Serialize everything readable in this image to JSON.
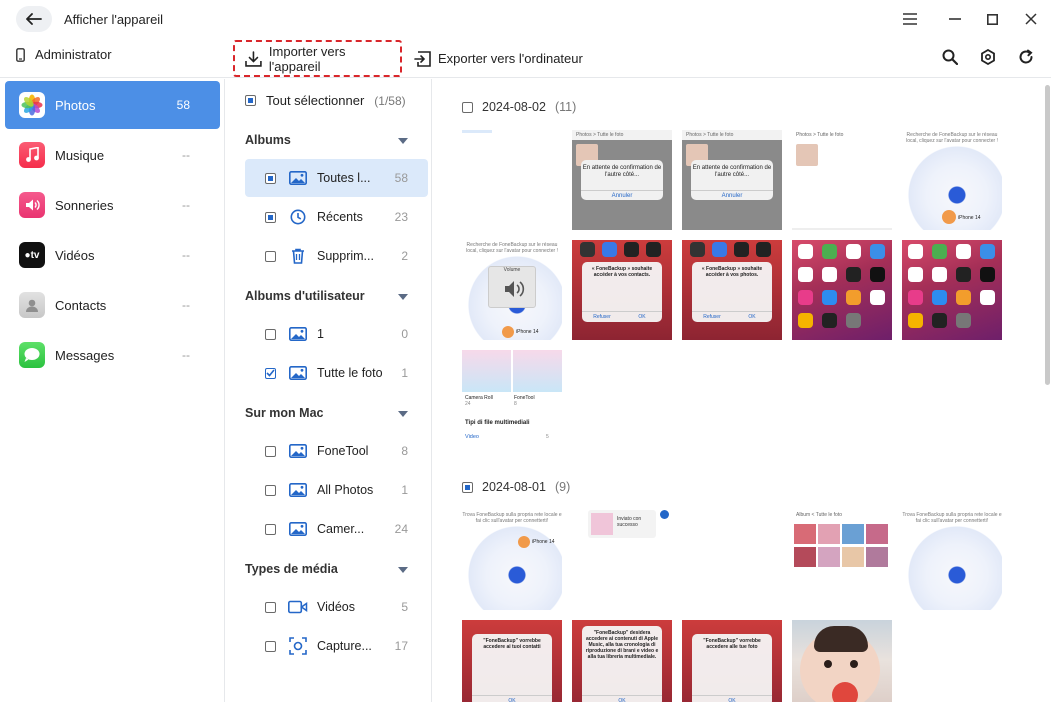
{
  "window": {
    "title": "Afficher l'appareil"
  },
  "toolbar": {
    "device_name": "Administrator",
    "import_label": "Importer vers l'appareil",
    "export_label": "Exporter vers l'ordinateur"
  },
  "sidebar": {
    "items": [
      {
        "label": "Photos",
        "count": "58",
        "active": true,
        "icon": "photos-icon"
      },
      {
        "label": "Musique",
        "count": "--",
        "icon": "music-icon"
      },
      {
        "label": "Sonneries",
        "count": "--",
        "icon": "ringtone-icon"
      },
      {
        "label": "Vidéos",
        "count": "--",
        "icon": "tv-icon"
      },
      {
        "label": "Contacts",
        "count": "--",
        "icon": "contacts-icon"
      },
      {
        "label": "Messages",
        "count": "--",
        "icon": "messages-icon"
      }
    ]
  },
  "albums_panel": {
    "select_all_label": "Tout sélectionner",
    "select_all_count": "(1/58)",
    "sections": [
      {
        "title": "Albums",
        "rows": [
          {
            "label": "Toutes l...",
            "count": "58",
            "state": "partial",
            "icon": "image-icon",
            "active": true
          },
          {
            "label": "Récents",
            "count": "23",
            "state": "partial",
            "icon": "clock-icon"
          },
          {
            "label": "Supprim...",
            "count": "2",
            "state": "none",
            "icon": "trash-icon"
          }
        ]
      },
      {
        "title": "Albums d'utilisateur",
        "rows": [
          {
            "label": "1",
            "count": "0",
            "state": "none",
            "icon": "image-icon"
          },
          {
            "label": "Tutte le foto",
            "count": "1",
            "state": "checked",
            "icon": "image-icon"
          }
        ]
      },
      {
        "title": "Sur mon Mac",
        "rows": [
          {
            "label": "FoneTool",
            "count": "8",
            "state": "none",
            "icon": "image-icon"
          },
          {
            "label": "All Photos",
            "count": "1",
            "state": "none",
            "icon": "image-icon"
          },
          {
            "label": "Camer...",
            "count": "24",
            "state": "none",
            "icon": "image-icon"
          }
        ]
      },
      {
        "title": "Types de média",
        "rows": [
          {
            "label": "Vidéos",
            "count": "5",
            "state": "none",
            "icon": "video-icon"
          },
          {
            "label": "Capture...",
            "count": "17",
            "state": "none",
            "icon": "screenshot-icon"
          }
        ]
      }
    ]
  },
  "grid": {
    "groups": [
      {
        "date": "2024-08-02",
        "count": "(11)",
        "state": "none"
      },
      {
        "date": "2024-08-01",
        "count": "(9)",
        "state": "partial"
      }
    ],
    "thumb_text": {
      "waiting_confirm": "En attente de confirmation de l'autre côté...",
      "annuler": "Annuler",
      "photos_crumb": "Photos  >  Tutte le foto",
      "radar_hint_fr": "Recherche de FoneBackup sur le réseau local, cliquez sur l'avatar pour connecter !",
      "iphone14": "iPhone 14",
      "volume": "Volume",
      "contacts_request": "« FoneBackup » souhaite accéder à vos contacts.",
      "photos_request": "« FoneBackup » souhaite accéder à vos photos.",
      "refuser": "Refuser",
      "ok": "OK",
      "camera_roll": "Camera Roll",
      "camera_roll_count": "24",
      "fonetool": "FoneTool",
      "fonetool_count": "8",
      "media_types": "Tipi di file multimediali",
      "video": "Video",
      "video_count": "5",
      "radar_hint_it": "Trova FoneBackup sulla propria rete locale e fai clic sull'avatar per connetterti!",
      "invio_success": "Inviato con successo",
      "album_crumb": "Album  <  Tutte le foto",
      "contacts_request_it": "\"FoneBackup\" vorrebbe accedere ai tuoi contatti",
      "music_request_it": "\"FoneBackup\" desidera accedere ai contenuti di Apple Music, alla tua cronologia di riproduzione di brani e video e alla tua libreria multimediale.",
      "photos_request_it": "\"FoneBackup\" vorrebbe accedere alle tue foto"
    }
  },
  "colors": {
    "accent": "#4c8fe6",
    "highlight_border": "#d9262b",
    "checkbox_blue": "#2467c8",
    "active_album_bg": "#dbe9fa"
  }
}
